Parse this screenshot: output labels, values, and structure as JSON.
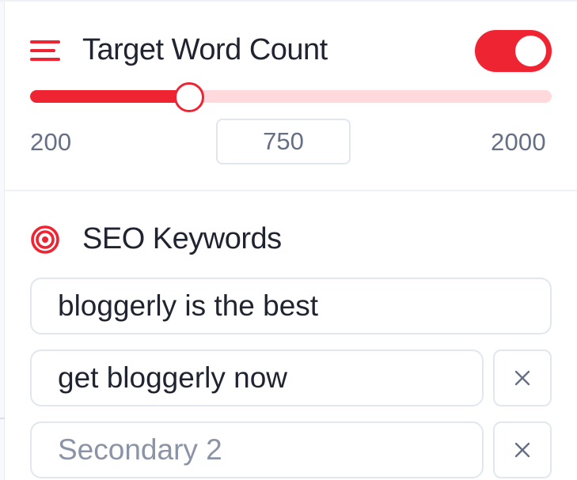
{
  "target_word_count": {
    "title": "Target Word Count",
    "toggle_enabled": true,
    "min_label": "200",
    "max_label": "2000",
    "min_value": 200,
    "max_value": 2000,
    "current_value": "750",
    "current_number": 750
  },
  "seo_keywords": {
    "title": "SEO Keywords",
    "primary_value": "bloggerly is the best",
    "secondary_1_value": "get bloggerly now",
    "secondary_2_placeholder": "Secondary 2",
    "remove_symbol": "×"
  },
  "icons": {
    "target_word_count": "menu-lines-icon",
    "seo_keywords": "target-icon",
    "remove": "close-icon"
  },
  "colors": {
    "accent": "#ee2432",
    "accent_light": "#ffd9dc",
    "border": "#e2e7ef",
    "text": "#1f2430",
    "muted_text": "#667085"
  }
}
